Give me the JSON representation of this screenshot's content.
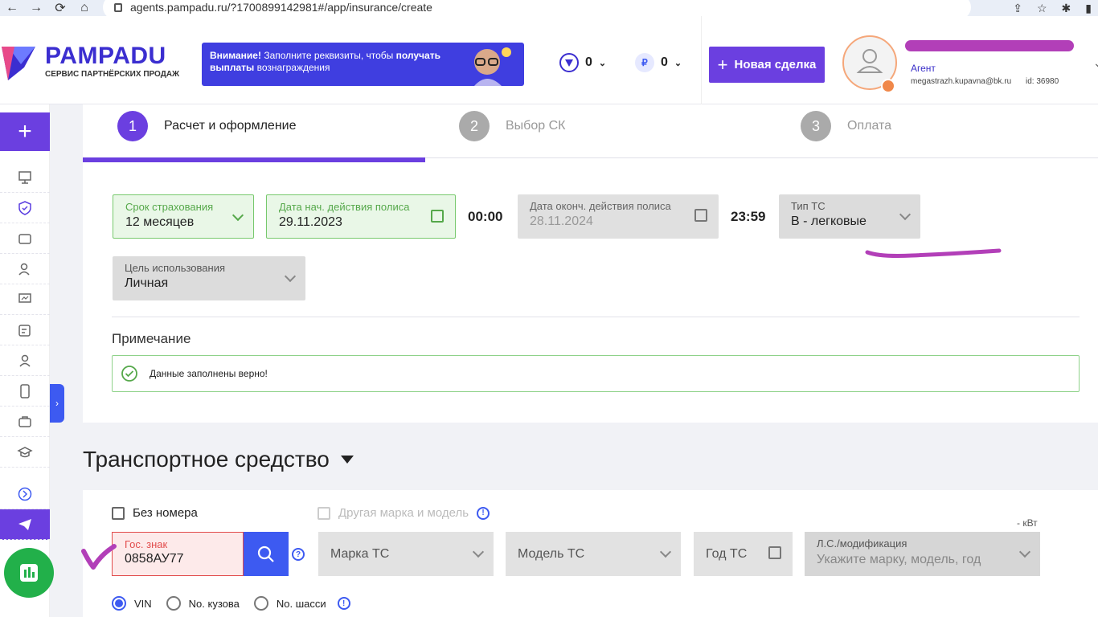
{
  "browser": {
    "url": "agents.pampadu.ru/?1700899142981#/app/insurance/create"
  },
  "header": {
    "logo_title": "PAMPADU",
    "logo_subtitle": "СЕРВИС ПАРТНЁРСКИХ ПРОДАЖ",
    "banner": {
      "attention": "Внимание!",
      "text1": " Заполните реквизиты, чтобы ",
      "bold1": "получать",
      "bold2": "выплаты",
      "text2": " вознаграждения"
    },
    "counter_shield": "0",
    "counter_ruble": "0",
    "ruble_symbol": "₽",
    "new_deal_label": "Новая сделка",
    "user": {
      "role": "Агент",
      "email": "megastrazh.kupavna@bk.ru",
      "id": "id: 36980"
    }
  },
  "steps": [
    {
      "num": "1",
      "label": "Расчет и оформление",
      "active": true
    },
    {
      "num": "2",
      "label": "Выбор СК",
      "active": false
    },
    {
      "num": "3",
      "label": "Оплата",
      "active": false
    }
  ],
  "form": {
    "term": {
      "label": "Срок страхования",
      "value": "12 месяцев"
    },
    "start_date": {
      "label": "Дата нач. действия полиса",
      "value": "29.11.2023"
    },
    "start_time": "00:00",
    "end_date": {
      "label": "Дата оконч. действия полиса",
      "value": "28.11.2024"
    },
    "end_time": "23:59",
    "vehicle_type": {
      "label": "Тип ТС",
      "value": "B - легковые"
    },
    "purpose": {
      "label": "Цель использования",
      "value": "Личная"
    },
    "note_title": "Примечание",
    "note_text": "Данные заполнены верно!"
  },
  "vehicle": {
    "section_title": "Транспортное средство",
    "no_plate_label": "Без номера",
    "other_brand_label": "Другая марка и модель",
    "kvt_label": "- кВт",
    "plate": {
      "label": "Гос. знак",
      "value": "0858АУ77"
    },
    "brand_placeholder": "Марка ТС",
    "model_placeholder": "Модель ТС",
    "year_placeholder": "Год ТС",
    "modification": {
      "label": "Л.С./модификация",
      "placeholder": "Укажите марку, модель, год"
    },
    "id_types": [
      "VIN",
      "No. кузова",
      "No. шасси"
    ],
    "selected_id_type": "VIN"
  },
  "colors": {
    "accent_purple": "#6b3fe0",
    "brand_blue": "#3b2ed0",
    "success_green": "#77c96d",
    "error_red": "#e24c4c",
    "annotation_magenta": "#b23fb8"
  }
}
